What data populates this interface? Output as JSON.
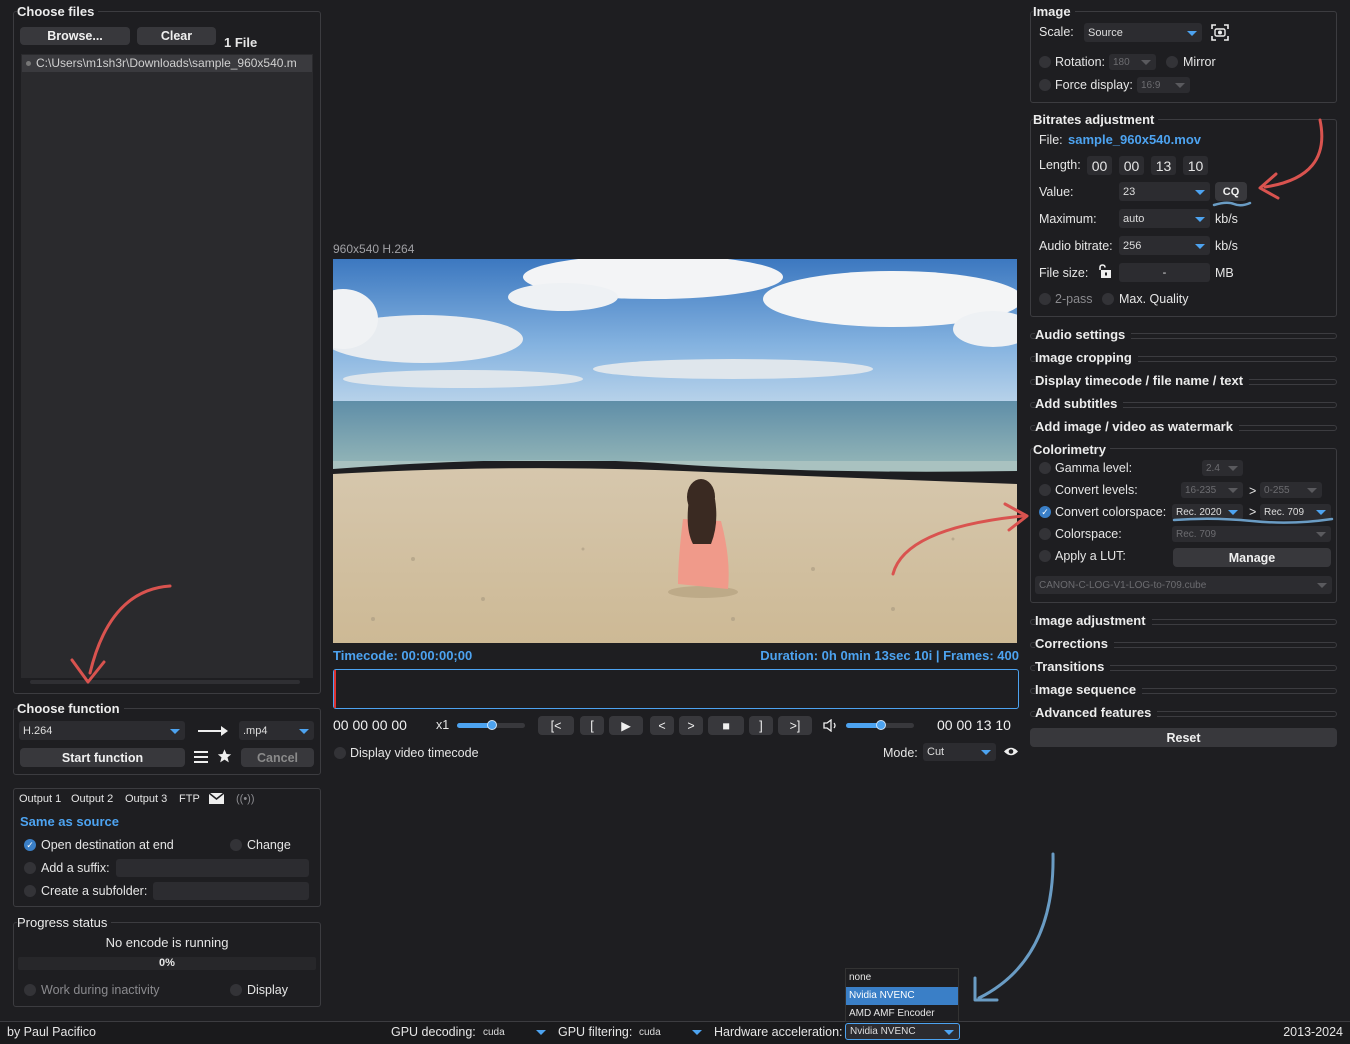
{
  "choose_files": {
    "title": "Choose files",
    "browse": "Browse...",
    "clear": "Clear",
    "count": "1 File",
    "file": "C:\\Users\\m1sh3r\\Downloads\\sample_960x540.m"
  },
  "choose_function": {
    "title": "Choose function",
    "codec": "H.264",
    "container": ".mp4",
    "start": "Start function",
    "cancel": "Cancel"
  },
  "outputs": {
    "tabs": [
      "Output 1",
      "Output 2",
      "Output 3",
      "FTP"
    ],
    "destination": "Same as source",
    "open_dest": "Open destination at end",
    "change": "Change",
    "suffix": "Add a suffix:",
    "subfolder": "Create a subfolder:"
  },
  "progress": {
    "title": "Progress status",
    "status": "No encode is running",
    "percent": "0%",
    "fill": 0,
    "work": "Work during inactivity",
    "display": "Display"
  },
  "video": {
    "info": "960x540 H.264",
    "timecode": "Timecode: 00:00:00;00",
    "duration": "Duration: 0h 0min 13sec 10i | Frames: 400",
    "tc_start": "00 00 00 00",
    "speed": "x1",
    "btn_in": "[<",
    "btn_mark_in": "[",
    "btn_play": "▶",
    "btn_prev": "<",
    "btn_next": ">",
    "btn_stop": "■",
    "btn_mark_out": "]",
    "btn_out": ">]",
    "tc_end": "00 00 13 10",
    "show_tc": "Display video timecode",
    "mode_label": "Mode:",
    "mode": "Cut"
  },
  "image": {
    "title": "Image",
    "scale_label": "Scale:",
    "scale": "Source",
    "rotation": "Rotation:",
    "rotation_val": "180",
    "mirror": "Mirror",
    "force": "Force display:",
    "force_val": "16:9"
  },
  "bitrate": {
    "title": "Bitrates adjustment",
    "file_label": "File:",
    "file": "sample_960x540.mov",
    "length_label": "Length:",
    "length": [
      "00",
      "00",
      "13",
      "10"
    ],
    "value_label": "Value:",
    "value": "23",
    "cq": "CQ",
    "max_label": "Maximum:",
    "max": "auto",
    "kbs": "kb/s",
    "audio_label": "Audio bitrate:",
    "audio": "256",
    "size_label": "File size:",
    "size": "-",
    "mb": "MB",
    "twopass": "2-pass",
    "maxq": "Max. Quality"
  },
  "sections": [
    "Audio settings",
    "Image cropping",
    "Display timecode / file name / text",
    "Add subtitles",
    "Add image / video as watermark"
  ],
  "colorimetry": {
    "title": "Colorimetry",
    "gamma": "Gamma level:",
    "gamma_val": "2.4",
    "levels": "Convert levels:",
    "levels_from": "16-235",
    "levels_to": "0-255",
    "gt": ">",
    "cs": "Convert colorspace:",
    "cs_from": "Rec. 2020",
    "cs_to": "Rec. 709",
    "colorspace": "Colorspace:",
    "colorspace_val": "Rec. 709",
    "lut": "Apply a LUT:",
    "manage": "Manage",
    "lut_file": "CANON-C-LOG-V1-LOG-to-709.cube"
  },
  "sections2": [
    "Image adjustment",
    "Corrections",
    "Transitions",
    "Image sequence",
    "Advanced features"
  ],
  "reset": "Reset",
  "statusbar": {
    "author": "by Paul Pacifico",
    "gpu_dec": "GPU decoding:",
    "gpu_dec_val": "cuda",
    "gpu_filt": "GPU filtering:",
    "gpu_filt_val": "cuda",
    "hw": "Hardware acceleration:",
    "hw_val": "Nvidia NVENC",
    "years": "2013-2024"
  },
  "hw_menu": [
    "none",
    "Nvidia NVENC",
    "AMD AMF Encoder"
  ],
  "colors": {
    "accent": "#4da3f0",
    "annotation_red": "#d9534f",
    "annotation_blue": "#6a9cc4"
  }
}
